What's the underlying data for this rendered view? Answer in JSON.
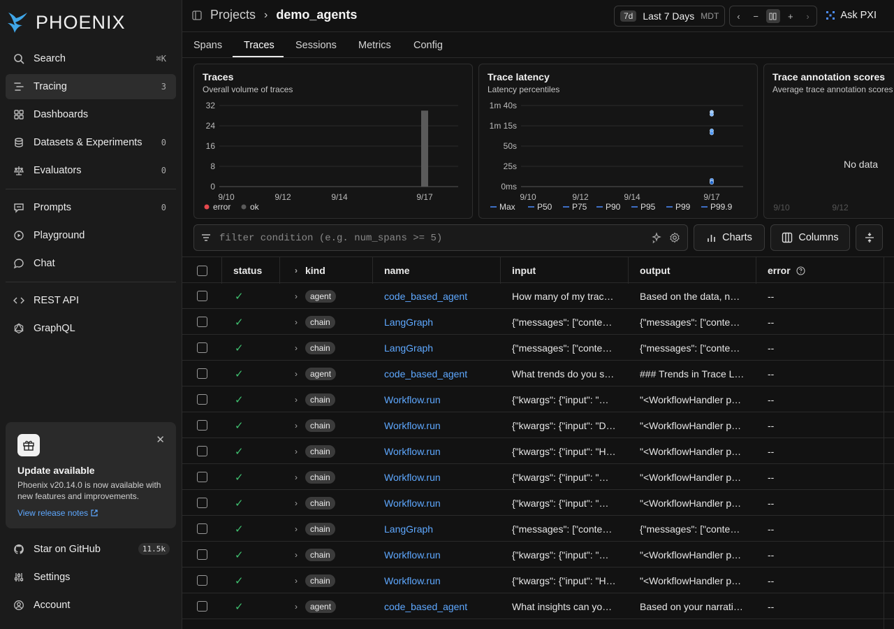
{
  "app": {
    "name": "PHOENIX"
  },
  "sidebar": {
    "items": [
      {
        "label": "Search",
        "shortcut": "⌘K",
        "icon": "search-icon"
      },
      {
        "label": "Tracing",
        "count": "3",
        "icon": "tracing-icon"
      },
      {
        "label": "Dashboards",
        "icon": "dashboard-icon"
      },
      {
        "label": "Datasets & Experiments",
        "count": "0",
        "icon": "database-icon"
      },
      {
        "label": "Evaluators",
        "count": "0",
        "icon": "scale-icon"
      },
      {
        "label": "Prompts",
        "count": "0",
        "icon": "prompt-icon"
      },
      {
        "label": "Playground",
        "icon": "play-icon"
      },
      {
        "label": "Chat",
        "icon": "chat-icon"
      },
      {
        "label": "REST API",
        "icon": "code-icon"
      },
      {
        "label": "GraphQL",
        "icon": "graphql-icon"
      }
    ],
    "update": {
      "title": "Update available",
      "body": "Phoenix v20.14.0 is now available with new features and improvements.",
      "link": "View release notes"
    },
    "bottom": [
      {
        "label": "Star on GitHub",
        "count": "11.5k",
        "icon": "github-icon"
      },
      {
        "label": "Settings",
        "icon": "settings-icon"
      },
      {
        "label": "Account",
        "icon": "account-icon"
      }
    ]
  },
  "header": {
    "crumb_root": "Projects",
    "crumb_project": "demo_agents",
    "time_badge": "7d",
    "time_label": "Last 7 Days",
    "timezone": "MDT",
    "ask_label": "Ask PXI"
  },
  "tabs": [
    "Spans",
    "Traces",
    "Sessions",
    "Metrics",
    "Config"
  ],
  "charts": {
    "traces": {
      "title": "Traces",
      "subtitle": "Overall volume of traces"
    },
    "latency": {
      "title": "Trace latency",
      "subtitle": "Latency percentiles"
    },
    "annotations": {
      "title": "Trace annotation scores",
      "subtitle": "Average trace annotation scores",
      "empty": "No data"
    }
  },
  "chart_data": [
    {
      "type": "bar",
      "title": "Traces",
      "x_ticks": [
        "9/10",
        "9/12",
        "9/14",
        "9/17"
      ],
      "y_ticks": [
        "0",
        "8",
        "16",
        "24",
        "32"
      ],
      "ylim": [
        0,
        32
      ],
      "series": [
        {
          "name": "error",
          "color": "#e5484d",
          "points": []
        },
        {
          "name": "ok",
          "color": "#5a5a5a",
          "points": [
            {
              "x": "9/17",
              "y": 30
            }
          ]
        }
      ],
      "legend": "bottom-left"
    },
    {
      "type": "scatter",
      "title": "Trace latency",
      "x_ticks": [
        "9/10",
        "9/12",
        "9/14",
        "9/17"
      ],
      "y_ticks": [
        "0ms",
        "25s",
        "50s",
        "1m 15s",
        "1m 40s"
      ],
      "ylim_seconds": [
        0,
        100
      ],
      "series_names": [
        "Max",
        "P50",
        "P75",
        "P90",
        "P95",
        "P99",
        "P99.9"
      ],
      "points_seconds": [
        {
          "x": "9/17",
          "values": [
            92,
            89,
            69,
            66,
            8,
            6,
            5
          ]
        }
      ],
      "legend": "bottom"
    },
    {
      "type": "scatter",
      "title": "Trace annotation scores",
      "x_ticks": [
        "9/10",
        "9/12"
      ],
      "empty_label": "No data"
    }
  ],
  "filter": {
    "placeholder": "filter condition (e.g. num_spans >= 5)"
  },
  "buttons": {
    "charts": "Charts",
    "columns": "Columns"
  },
  "table": {
    "columns": [
      "status",
      "kind",
      "name",
      "input",
      "output",
      "error"
    ],
    "rows": [
      {
        "kind": "agent",
        "name": "code_based_agent",
        "input": "How many of my trac…",
        "output": "Based on the data, no…",
        "error": "--"
      },
      {
        "kind": "chain",
        "name": "LangGraph",
        "input": "{\"messages\": [\"conten…",
        "output": "{\"messages\": [\"conten…",
        "error": "--"
      },
      {
        "kind": "chain",
        "name": "LangGraph",
        "input": "{\"messages\": [\"conten…",
        "output": "{\"messages\": [\"conten…",
        "error": "--"
      },
      {
        "kind": "agent",
        "name": "code_based_agent",
        "input": "What trends do you s…",
        "output": "### Trends in Trace La…",
        "error": "--"
      },
      {
        "kind": "chain",
        "name": "Workflow.run",
        "input": "{\"kwargs\": {\"input\": \"W…",
        "output": "\"<WorkflowHandler pe…",
        "error": "--"
      },
      {
        "kind": "chain",
        "name": "Workflow.run",
        "input": "{\"kwargs\": {\"input\": \"D…",
        "output": "\"<WorkflowHandler pe…",
        "error": "--"
      },
      {
        "kind": "chain",
        "name": "Workflow.run",
        "input": "{\"kwargs\": {\"input\": \"H…",
        "output": "\"<WorkflowHandler pe…",
        "error": "--"
      },
      {
        "kind": "chain",
        "name": "Workflow.run",
        "input": "{\"kwargs\": {\"input\": \"W…",
        "output": "\"<WorkflowHandler pe…",
        "error": "--"
      },
      {
        "kind": "chain",
        "name": "Workflow.run",
        "input": "{\"kwargs\": {\"input\": \"W…",
        "output": "\"<WorkflowHandler pe…",
        "error": "--"
      },
      {
        "kind": "chain",
        "name": "LangGraph",
        "input": "{\"messages\": [\"conten…",
        "output": "{\"messages\": [\"conten…",
        "error": "--"
      },
      {
        "kind": "chain",
        "name": "Workflow.run",
        "input": "{\"kwargs\": {\"input\": \"W…",
        "output": "\"<WorkflowHandler pe…",
        "error": "--"
      },
      {
        "kind": "chain",
        "name": "Workflow.run",
        "input": "{\"kwargs\": {\"input\": \"H…",
        "output": "\"<WorkflowHandler pe…",
        "error": "--"
      },
      {
        "kind": "agent",
        "name": "code_based_agent",
        "input": "What insights can you…",
        "output": "Based on your narrativ…",
        "error": "--"
      }
    ]
  },
  "colors": {
    "accent": "#5ea8ff",
    "ok": "#3fbf6f",
    "error": "#e5484d",
    "background": "#121212"
  }
}
